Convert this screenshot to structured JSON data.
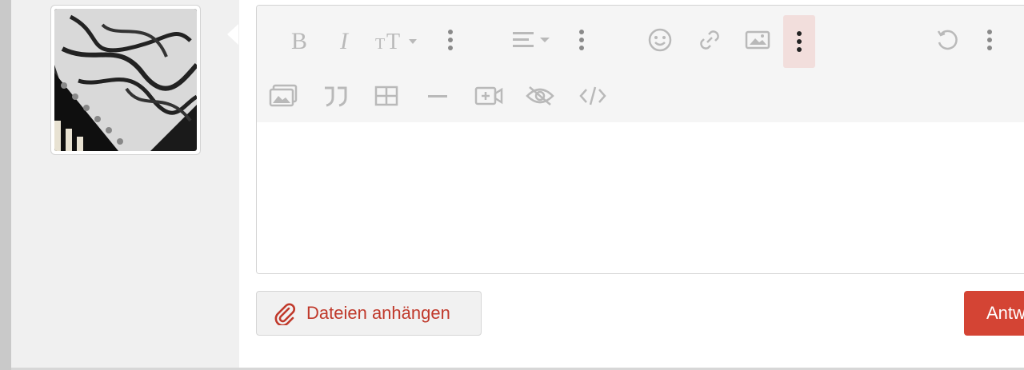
{
  "composer": {
    "attach_label": "Dateien anhängen",
    "reply_label": "Antworten"
  },
  "toolbar": {
    "row1": [
      {
        "name": "bold-icon"
      },
      {
        "name": "italic-icon"
      },
      {
        "name": "font-size-icon"
      },
      {
        "name": "more-text-icon"
      },
      {
        "name": "align-icon"
      },
      {
        "name": "more-paragraph-icon"
      },
      {
        "name": "emoji-icon"
      },
      {
        "name": "link-icon"
      },
      {
        "name": "image-icon"
      },
      {
        "name": "more-insert-icon",
        "active": true
      },
      {
        "name": "undo-icon"
      },
      {
        "name": "more-misc-icon"
      }
    ],
    "row2": [
      {
        "name": "gallery-icon"
      },
      {
        "name": "quote-icon"
      },
      {
        "name": "table-icon"
      },
      {
        "name": "horizontal-rule-icon"
      },
      {
        "name": "media-icon"
      },
      {
        "name": "spoiler-icon"
      },
      {
        "name": "code-icon"
      }
    ]
  },
  "colors": {
    "accent": "#d44434",
    "accent_text": "#c0392b",
    "toolbar_bg": "#f5f5f5",
    "icon": "#b9b9b9",
    "active_bg": "#f2dedc"
  }
}
